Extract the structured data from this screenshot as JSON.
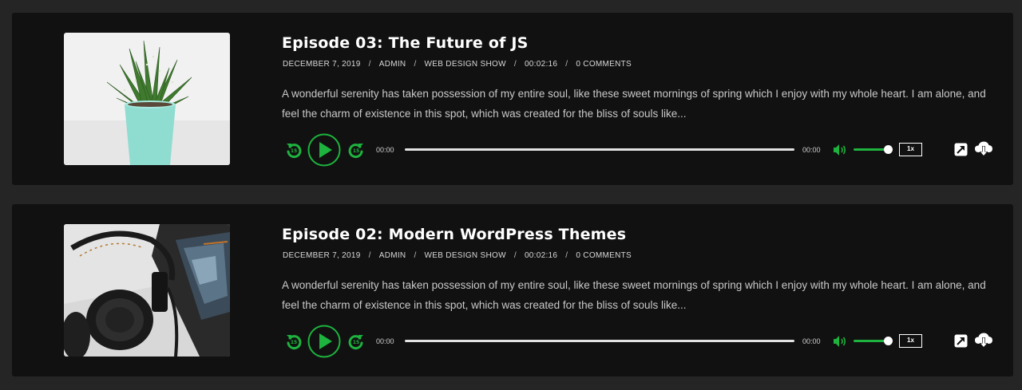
{
  "colors": {
    "accent": "#1db33e",
    "card_bg": "#111111",
    "page_bg": "#252525"
  },
  "episodes": [
    {
      "title": "Episode 03: The Future of JS",
      "date": "DECEMBER 7, 2019",
      "author": "ADMIN",
      "show": "WEB DESIGN SHOW",
      "duration": "00:02:16",
      "comments": "0 COMMENTS",
      "separator": "/",
      "excerpt": "A wonderful serenity has taken possession of my entire soul, like these sweet mornings of spring which I enjoy with my whole heart. I am alone, and feel the charm of existence in this spot, which was created for the bliss of souls like...",
      "thumbnail": "potted-succulent-image",
      "player": {
        "current_time": "00:00",
        "total_time": "00:00",
        "speed": "1x",
        "progress": 0,
        "volume": 1
      }
    },
    {
      "title": "Episode 02: Modern WordPress Themes",
      "date": "DECEMBER 7, 2019",
      "author": "ADMIN",
      "show": "WEB DESIGN SHOW",
      "duration": "00:02:16",
      "comments": "0 COMMENTS",
      "separator": "/",
      "excerpt": "A wonderful serenity has taken possession of my entire soul, like these sweet mornings of spring which I enjoy with my whole heart. I am alone, and feel the charm of existence in this spot, which was created for the bliss of souls like...",
      "thumbnail": "headphones-and-tablet-image",
      "player": {
        "current_time": "00:00",
        "total_time": "00:00",
        "speed": "1x",
        "progress": 0,
        "volume": 1
      }
    }
  ]
}
